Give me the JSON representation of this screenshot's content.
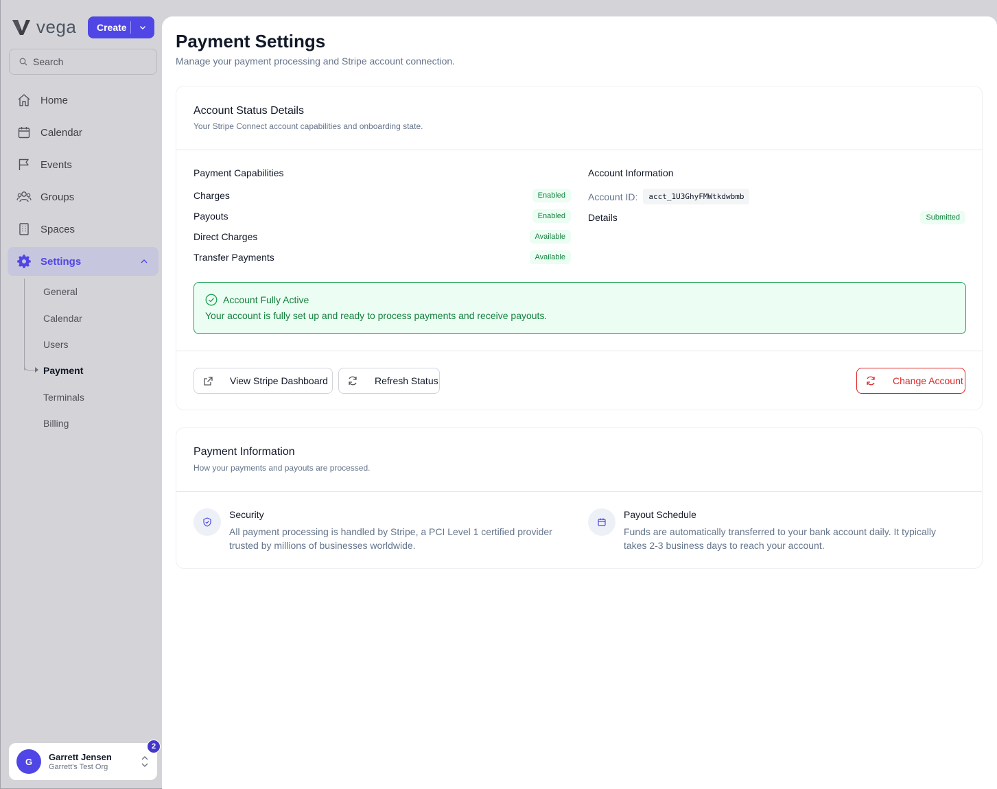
{
  "app": {
    "name": "vega"
  },
  "sidebar": {
    "create_label": "Create",
    "search_placeholder": "Search",
    "items": [
      {
        "label": "Home",
        "icon": "home-icon"
      },
      {
        "label": "Calendar",
        "icon": "calendar-icon"
      },
      {
        "label": "Events",
        "icon": "flag-icon"
      },
      {
        "label": "Groups",
        "icon": "users-icon"
      },
      {
        "label": "Spaces",
        "icon": "building-icon"
      },
      {
        "label": "Settings",
        "icon": "gear-icon",
        "active": true
      }
    ],
    "settings_sub": [
      {
        "label": "General"
      },
      {
        "label": "Calendar"
      },
      {
        "label": "Users"
      },
      {
        "label": "Payment",
        "active": true
      },
      {
        "label": "Terminals"
      },
      {
        "label": "Billing"
      }
    ],
    "user": {
      "initial": "G",
      "name": "Garrett Jensen",
      "org": "Garrett's Test Org",
      "notifications": "2"
    }
  },
  "page": {
    "title": "Payment Settings",
    "subtitle": "Manage your payment processing and Stripe account connection."
  },
  "account_status": {
    "title": "Account Status Details",
    "subtitle": "Your Stripe Connect account capabilities and onboarding state.",
    "capabilities_heading": "Payment Capabilities",
    "capabilities": [
      {
        "label": "Charges",
        "status": "Enabled"
      },
      {
        "label": "Payouts",
        "status": "Enabled"
      },
      {
        "label": "Direct Charges",
        "status": "Available"
      },
      {
        "label": "Transfer Payments",
        "status": "Available"
      }
    ],
    "account_info_heading": "Account Information",
    "account_id_label": "Account ID:",
    "account_id": "acct_1U3GhyFMWtkdwbmb",
    "details_label": "Details",
    "details_status": "Submitted",
    "alert_title": "Account Fully Active",
    "alert_desc": "Your account is fully set up and ready to process payments and receive payouts.",
    "buttons": {
      "dashboard": "View Stripe Dashboard",
      "refresh": "Refresh Status",
      "change": "Change Account"
    }
  },
  "payment_info": {
    "title": "Payment Information",
    "subtitle": "How your payments and payouts are processed.",
    "security_title": "Security",
    "security_desc": "All payment processing is handled by Stripe, a PCI Level 1 certified provider trusted by millions of businesses worldwide.",
    "payout_title": "Payout Schedule",
    "payout_desc": "Funds are automatically transferred to your bank account daily. It typically takes 2-3 business days to reach your account."
  },
  "colors": {
    "accent": "#4f46e5",
    "success": "#15803d",
    "danger": "#dc2626"
  }
}
